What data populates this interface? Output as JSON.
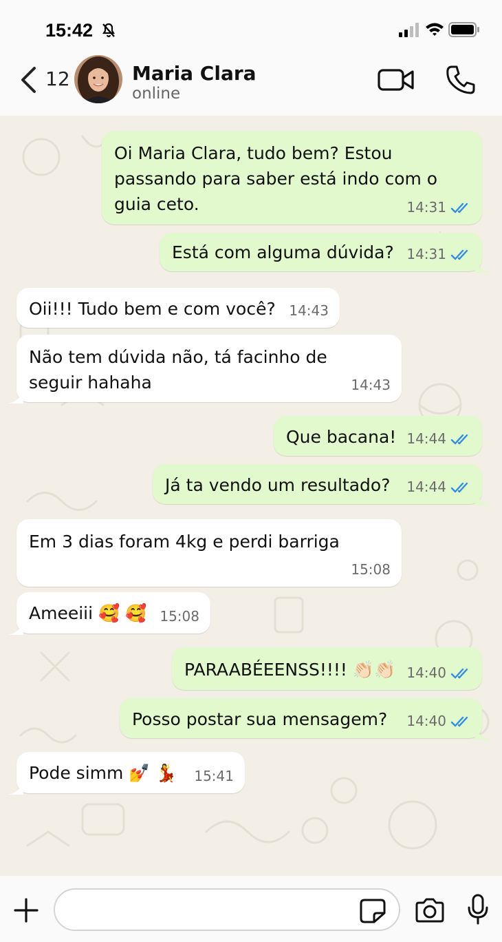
{
  "status_bar": {
    "time": "15:42"
  },
  "header": {
    "back_count": "12",
    "contact_name": "Maria Clara",
    "contact_status": "online"
  },
  "messages": [
    {
      "direction": "out",
      "lines": [
        "Oi Maria Clara, tudo bem? Estou",
        "passando para saber está indo com o",
        "guia ceto."
      ],
      "time": "14:31",
      "read": true
    },
    {
      "direction": "out",
      "lines": [
        "Está com alguma dúvida?"
      ],
      "time": "14:31",
      "read": true
    },
    {
      "direction": "in",
      "lines": [
        "Oii!!! Tudo bem e com você?"
      ],
      "time": "14:43"
    },
    {
      "direction": "in",
      "lines": [
        "Não tem dúvida não, tá facinho de",
        "seguir hahaha"
      ],
      "time": "14:43"
    },
    {
      "direction": "out",
      "lines": [
        "Que bacana!"
      ],
      "time": "14:44",
      "read": true
    },
    {
      "direction": "out",
      "lines": [
        "Já ta vendo um resultado?"
      ],
      "time": "14:44",
      "read": true
    },
    {
      "direction": "in",
      "lines": [
        "Em 3 dias foram 4kg e perdi barriga"
      ],
      "time": "15:08"
    },
    {
      "direction": "in",
      "lines": [
        "Ameeiii 🥰 🥰"
      ],
      "time": "15:08"
    },
    {
      "direction": "out",
      "lines": [
        "PARAABÉEENSS!!!! 👏🏻👏🏻"
      ],
      "time": "14:40",
      "read": true
    },
    {
      "direction": "out",
      "lines": [
        "Posso postar sua mensagem?"
      ],
      "time": "14:40",
      "read": true
    },
    {
      "direction": "in",
      "lines": [
        "Pode simm 💅 💃"
      ],
      "time": "15:41"
    }
  ],
  "input": {
    "placeholder": ""
  },
  "colors": {
    "outgoing_bubble": "#e2f8cd",
    "incoming_bubble": "#ffffff",
    "chat_background": "#f3efe6",
    "read_ticks": "#2f8de4"
  },
  "icons": [
    "bell-slash-icon",
    "signal-icon",
    "wifi-icon",
    "battery-icon",
    "chevron-left-icon",
    "video-camera-icon",
    "phone-icon",
    "plus-icon",
    "sticker-icon",
    "camera-icon",
    "microphone-icon",
    "double-check-icon"
  ]
}
